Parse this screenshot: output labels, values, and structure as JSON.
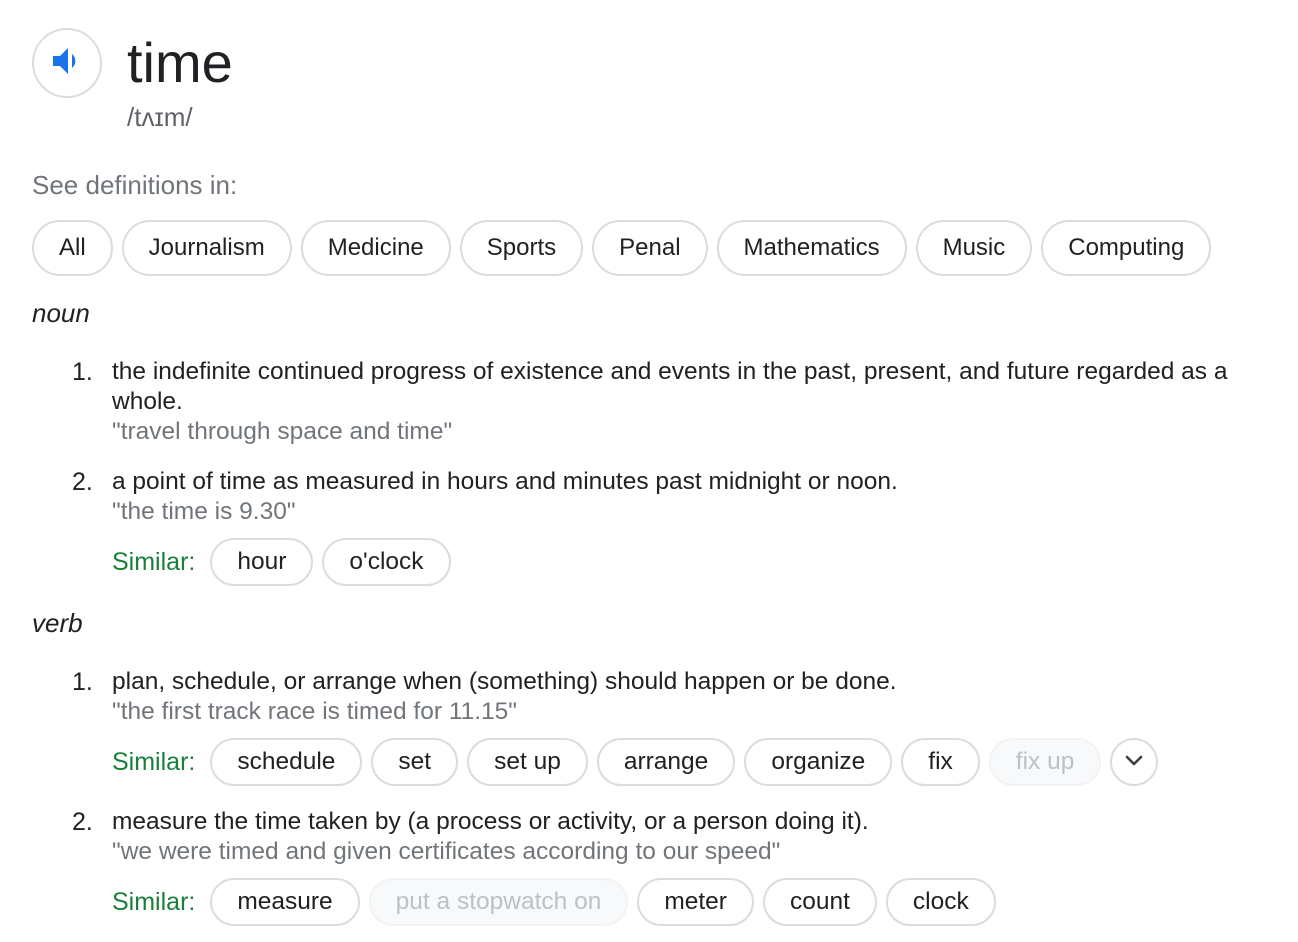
{
  "entry": {
    "headword": "time",
    "phonetic": "/tʌɪm/",
    "speaker_icon": "speaker-volume-icon",
    "accent_color": "#1a73e8"
  },
  "see_definitions": {
    "label": "See definitions in:",
    "categories": [
      "All",
      "Journalism",
      "Medicine",
      "Sports",
      "Penal",
      "Mathematics",
      "Music",
      "Computing"
    ]
  },
  "similar_label_color": "#188038",
  "noun": {
    "label": "noun",
    "senses": [
      {
        "number": "1.",
        "definition": "the indefinite continued progress of existence and events in the past, present, and future regarded as a whole.",
        "example": "\"travel through space and time\""
      },
      {
        "number": "2.",
        "definition": "a point of time as measured in hours and minutes past midnight or noon.",
        "example": "\"the time is 9.30\"",
        "similar_label": "Similar:",
        "similar": [
          "hour",
          "o'clock"
        ]
      }
    ]
  },
  "verb": {
    "label": "verb",
    "senses": [
      {
        "number": "1.",
        "definition": "plan, schedule, or arrange when (something) should happen or be done.",
        "example": "\"the first track race is timed for 11.15\"",
        "similar_label": "Similar:",
        "similar": [
          "schedule",
          "set",
          "set up",
          "arrange",
          "organize",
          "fix",
          "fix up"
        ],
        "more_icon": "chevron-down-icon"
      },
      {
        "number": "2.",
        "definition": "measure the time taken by (a process or activity, or a person doing it).",
        "example": "\"we were timed and given certificates according to our speed\"",
        "similar_label": "Similar:",
        "similar": [
          "measure",
          "put a stopwatch on",
          "meter",
          "count",
          "clock"
        ]
      }
    ]
  }
}
